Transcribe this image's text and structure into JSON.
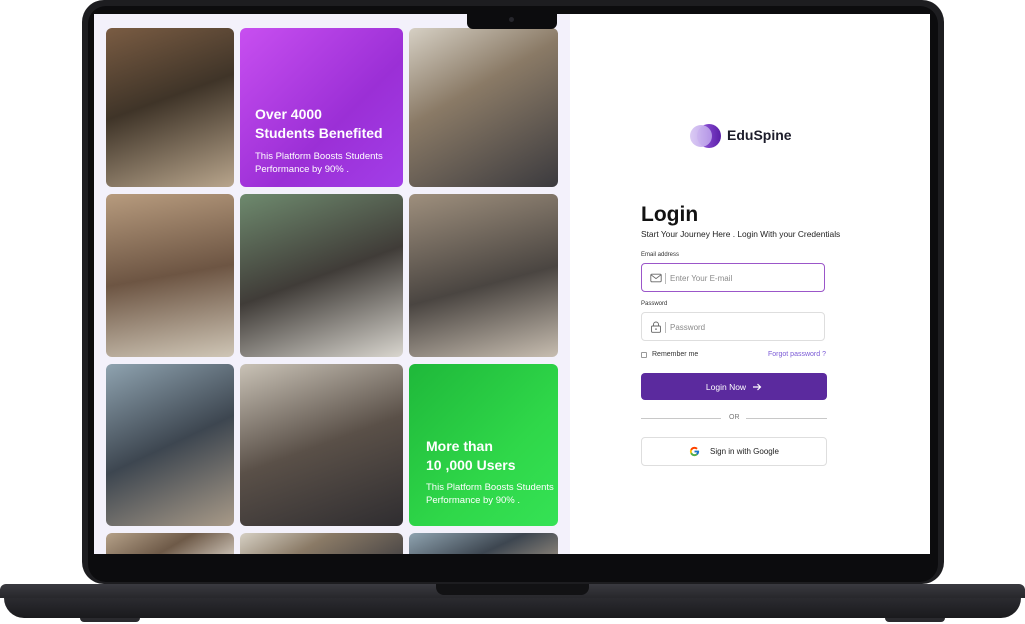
{
  "brand": {
    "name": "EduSpine",
    "logo_icon": "overlapping-circles-logo",
    "colors": {
      "primary": "#5b2a9e",
      "accent": "#7b5ad6",
      "purple_card": "#a23ee8",
      "green_card": "#2fd749"
    }
  },
  "collage": {
    "stat_cards": [
      {
        "title_line1": "Over 4000",
        "title_line2": "Students Benefited",
        "subtitle": "This Platform Boosts Students Performance by 90% ."
      },
      {
        "title_line1": "More than",
        "title_line2": "10 ,000 Users",
        "subtitle": "This Platform Boosts Students Performance by 90% ."
      }
    ]
  },
  "login": {
    "title": "Login",
    "subtitle": "Start Your Journey Here . Login With your Credentials",
    "email": {
      "label": "Email address",
      "placeholder": "Enter Your E-mail",
      "value": "",
      "icon": "mail-icon"
    },
    "password": {
      "label": "Password",
      "placeholder": "Password",
      "value": "",
      "icon": "lock-icon"
    },
    "remember_label": "Remember me",
    "remember_checked": false,
    "forgot_label": "Forgot password ?",
    "submit_label": "Login Now",
    "submit_icon": "arrow-right-icon",
    "divider_label": "OR",
    "google_label": "Sign in with Google",
    "google_icon": "google-icon"
  }
}
